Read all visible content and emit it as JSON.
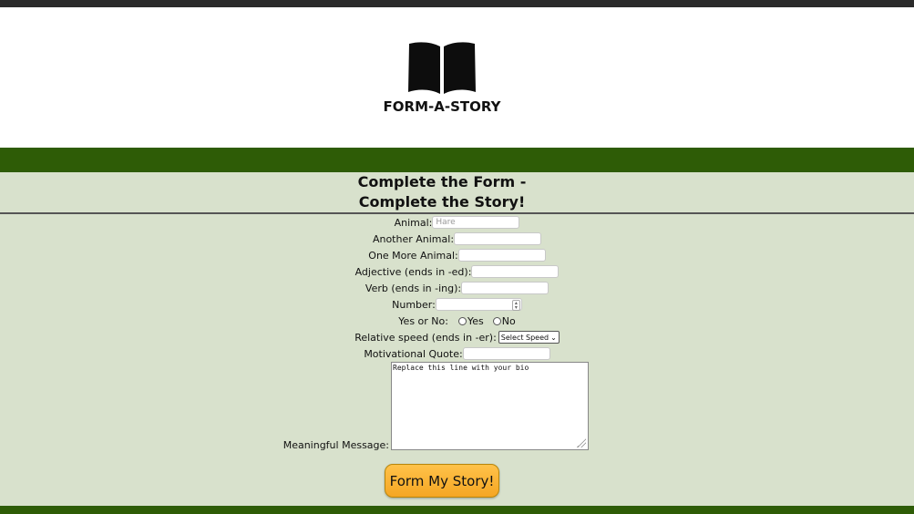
{
  "header": {
    "brand": "FORM-A-STORY",
    "logo_icon": "book-icon"
  },
  "form": {
    "heading_line1": "Complete the Form -",
    "heading_line2": "Complete the Story!",
    "fields": {
      "animal": {
        "label": "Animal:",
        "placeholder": "Hare"
      },
      "another_animal": {
        "label": "Another Animal:",
        "value": ""
      },
      "one_more_animal": {
        "label": "One More Animal:",
        "value": ""
      },
      "adjective": {
        "label": "Adjective (ends in -ed):",
        "value": ""
      },
      "verb": {
        "label": "Verb (ends in -ing):",
        "value": ""
      },
      "number": {
        "label": "Number:",
        "value": ""
      },
      "yes_or_no": {
        "label": "Yes or No:",
        "options": [
          "Yes",
          "No"
        ]
      },
      "relative_speed": {
        "label": "Relative speed (ends in -er):",
        "selected": "Select Speed"
      },
      "motivational_quote": {
        "label": "Motivational Quote:",
        "value": ""
      },
      "meaningful_message": {
        "label": "Meaningful Message:",
        "value": "Replace this line with your bio"
      }
    },
    "submit_label": "Form My Story!"
  },
  "colors": {
    "bar": "#2e5c06",
    "form_background": "#d8e1cc",
    "button": "#f5a623"
  }
}
